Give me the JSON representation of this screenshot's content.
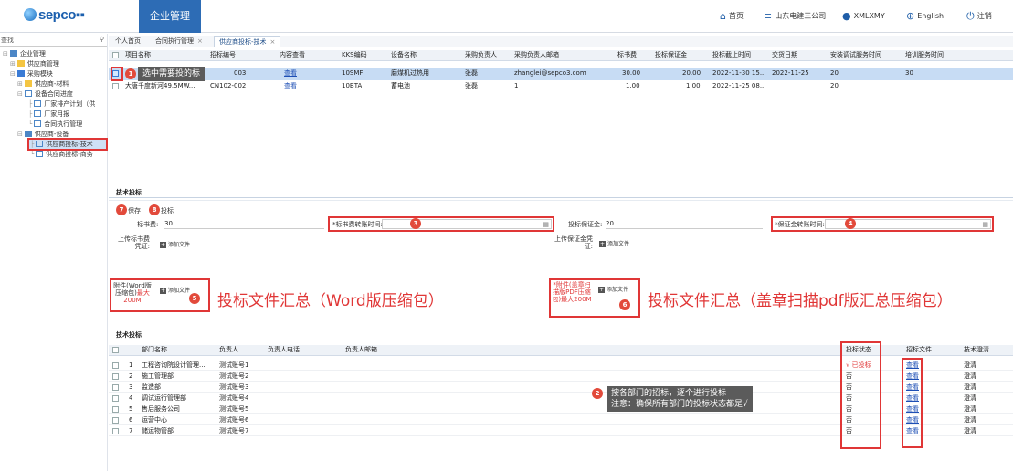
{
  "header": {
    "logo_text": "sepco",
    "module_label": "企业管理",
    "home_label": "首页",
    "company_label": "山东电建三公司",
    "user_label": "XMLXMY",
    "lang_label": "English",
    "logout_label": "注销"
  },
  "sidebar": {
    "search_placeholder": "查找",
    "items": [
      {
        "label": "企业管理"
      },
      {
        "label": "供应商管理"
      },
      {
        "label": "采购模块"
      },
      {
        "label": "供应商-材料"
      },
      {
        "label": "设备合同进度"
      },
      {
        "label": "厂家排产计划（供"
      },
      {
        "label": "厂家月报"
      },
      {
        "label": "合同执行管理"
      },
      {
        "label": "供应商-设备"
      },
      {
        "label": "供应商投标-技术"
      },
      {
        "label": "供应商投标-商务"
      }
    ]
  },
  "tabs": [
    {
      "label": "个人首页"
    },
    {
      "label": "合同执行管理"
    },
    {
      "label": "供应商投标-技术"
    }
  ],
  "grid1": {
    "columns": [
      "项目名称",
      "招标编号",
      "内容查看",
      "KKS编码",
      "设备名称",
      "采购负责人",
      "采购负责人邮箱",
      "标书费",
      "投标保证金",
      "投标截止时间",
      "交货日期",
      "安装调试服务时间",
      "培训服务时间"
    ],
    "rows": [
      {
        "project": "",
        "code": "003",
        "view": "查看",
        "kks": "10SMF",
        "device": "磨煤机过热用",
        "buyer": "张磊",
        "email": "zhanglei@sepco3.com",
        "fee": "30.00",
        "deposit": "20.00",
        "deadline": "2022-11-30 15...",
        "delivery": "2022-11-25",
        "install": "20",
        "train": "30"
      },
      {
        "project": "大唐千度新河49.5MW...",
        "code": "CN102-002",
        "view": "查看",
        "kks": "10BTA",
        "device": "蓄电池",
        "buyer": "张磊",
        "email": "1",
        "fee": "1.00",
        "deposit": "1.00",
        "deadline": "2022-11-25 08...",
        "delivery": "",
        "install": "20",
        "train": ""
      }
    ]
  },
  "tooltip1": "选中需要投的标",
  "form": {
    "section_title": "技术投标",
    "save_label": "保存",
    "submit_label": "投标",
    "fee_label": "标书费:",
    "fee_value": "30",
    "fee_time_label": "*标书费转账时间:",
    "deposit_label": "投标保证金:",
    "deposit_value": "20",
    "deposit_time_label": "*保证金转账时间:",
    "upload_fee_label": "上传标书费凭证:",
    "upload_deposit_label": "上传保证金凭证:",
    "add_file": "添加文件",
    "word_attach_label": "附件(Word版压缩包)",
    "word_attach_limit": "最大200M",
    "pdf_attach_label": "*附件(盖章扫描版PDF压缩包)",
    "pdf_attach_limit": "最大200M",
    "note_word": "投标文件汇总（Word版压缩包）",
    "note_pdf": "投标文件汇总（盖章扫描pdf版汇总压缩包）"
  },
  "grid2": {
    "section_title": "技术投标",
    "columns": [
      "部门名称",
      "负责人",
      "负责人电话",
      "负责人邮箱",
      "投标状态",
      "招标文件",
      "技术澄清"
    ],
    "rows": [
      {
        "no": "1",
        "dept": "工程咨询院设计管理...",
        "owner": "测试账号1",
        "status": "√ 已投标",
        "file": "查看",
        "clarify": "澄清"
      },
      {
        "no": "2",
        "dept": "施工管理部",
        "owner": "测试账号2",
        "status": "否",
        "file": "查看",
        "clarify": "澄清"
      },
      {
        "no": "3",
        "dept": "监造部",
        "owner": "测试账号3",
        "status": "否",
        "file": "查看",
        "clarify": "澄清"
      },
      {
        "no": "4",
        "dept": "调试运行管理部",
        "owner": "测试账号4",
        "status": "否",
        "file": "查看",
        "clarify": "澄清"
      },
      {
        "no": "5",
        "dept": "售后服务公司",
        "owner": "测试账号5",
        "status": "否",
        "file": "查看",
        "clarify": "澄清"
      },
      {
        "no": "6",
        "dept": "运营中心",
        "owner": "测试账号6",
        "status": "否",
        "file": "查看",
        "clarify": "澄清"
      },
      {
        "no": "7",
        "dept": "储运物管部",
        "owner": "测试账号7",
        "status": "否",
        "file": "查看",
        "clarify": "澄清"
      }
    ]
  },
  "tooltip2_line1": "按各部门的招标，逐个进行投标",
  "tooltip2_line2": "注意：确保所有部门的投标状态都是√",
  "badges": [
    "1",
    "2",
    "3",
    "4",
    "5",
    "6",
    "7",
    "8"
  ],
  "colors": {
    "accent": "#2d6cb5",
    "annotation": "#e03636"
  }
}
